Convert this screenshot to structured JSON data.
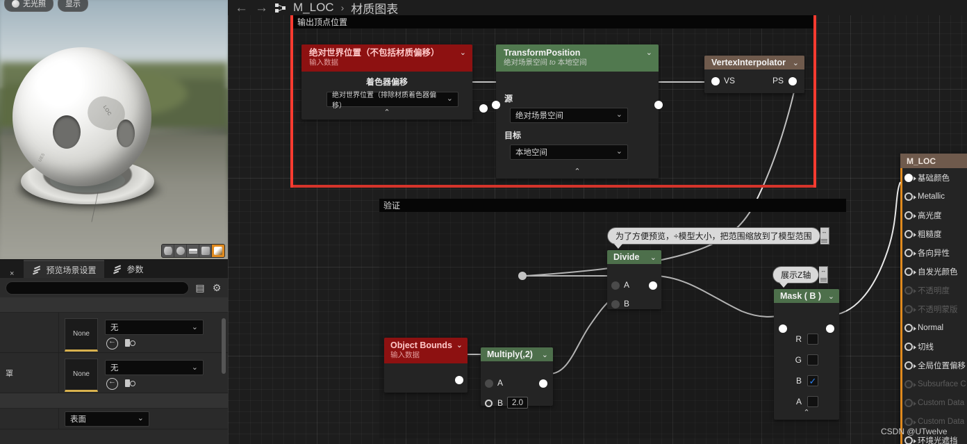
{
  "app": {
    "breadcrumb": {
      "asset": "M_LOC",
      "separator": "›",
      "section": "材质图表",
      "back_icon": "back-arrow-icon",
      "forward_icon": "forward-arrow-icon",
      "graph_icon": "material-graph-icon"
    },
    "watermark": "CSDN @UTwelve"
  },
  "viewport": {
    "buttons": [
      {
        "label": "无光照",
        "icon": "lighting-dot-icon"
      },
      {
        "label": "显示",
        "icon": "show-menu-icon"
      }
    ],
    "preview_shapes": [
      "cylinder-shape",
      "sphere-shape",
      "plane-shape",
      "cube-shape",
      "custom-mesh-shape"
    ]
  },
  "graph": {
    "comments": [
      {
        "title": "输出顶点位置",
        "highlight_color": "#ff3b30"
      },
      {
        "title": "验证",
        "highlight_color": "#060606"
      }
    ],
    "bubbles": [
      {
        "text": "为了方便预览，÷模型大小，把范围缩放到了模型范围"
      },
      {
        "text": "展示Z轴"
      }
    ],
    "nodes": {
      "abs_world_pos": {
        "title": "绝对世界位置（不包括材质偏移）",
        "subtitle": "输入数据",
        "field_label": "着色器偏移",
        "field_value": "绝对世界位置（排除材质着色器偏移）",
        "color": "#8d1111"
      },
      "transform_position": {
        "title": "TransformPosition",
        "subtitle_prefix": "绝对场景空间",
        "subtitle_italic": "to",
        "subtitle_suffix": "本地空间",
        "source_label": "源",
        "source_value": "绝对场景空间",
        "target_label": "目标",
        "target_value": "本地空间",
        "color": "#51794f"
      },
      "vertex_interpolator": {
        "title": "VertexInterpolator",
        "input_pin": "VS",
        "output_pin": "PS",
        "color": "#6f5a4c"
      },
      "divide": {
        "title": "Divide",
        "input_a": "A",
        "input_b": "B",
        "color": "#51794f"
      },
      "mask": {
        "title": "Mask ( B )",
        "channels": [
          {
            "label": "R",
            "checked": false
          },
          {
            "label": "G",
            "checked": false
          },
          {
            "label": "B",
            "checked": true
          },
          {
            "label": "A",
            "checked": false
          }
        ],
        "color": "#51794f"
      },
      "object_bounds": {
        "title": "Object Bounds",
        "subtitle": "输入数据",
        "color": "#8d1111"
      },
      "multiply": {
        "title": "Multiply(,2)",
        "input_a": "A",
        "input_b": "B",
        "b_value": "2.0",
        "color": "#51794f"
      }
    }
  },
  "details_panel": {
    "tabs": [
      {
        "label": "预览场景设置",
        "icon": "details-pen-icon",
        "active": true
      },
      {
        "label": "参数",
        "icon": "params-pen-icon",
        "active": false
      }
    ],
    "close_label": "×",
    "search_placeholder": "",
    "search_value": "",
    "toolbar_icons": [
      "grid-view-icon",
      "settings-gear-icon"
    ],
    "rows": [
      {
        "name": "",
        "thumb": "None",
        "value": "无"
      },
      {
        "name": "罩",
        "thumb": "None",
        "value": "无"
      }
    ],
    "surface_value": "表面"
  },
  "material_panel": {
    "title": "M_LOC",
    "pins": [
      {
        "label": "基础颜色",
        "enabled": true,
        "connected": true
      },
      {
        "label": "Metallic",
        "enabled": true,
        "connected": false
      },
      {
        "label": "高光度",
        "enabled": true,
        "connected": false
      },
      {
        "label": "粗糙度",
        "enabled": true,
        "connected": false
      },
      {
        "label": "各向异性",
        "enabled": true,
        "connected": false
      },
      {
        "label": "自发光颜色",
        "enabled": true,
        "connected": false
      },
      {
        "label": "不透明度",
        "enabled": false,
        "connected": false
      },
      {
        "label": "不透明蒙版",
        "enabled": false,
        "connected": false
      },
      {
        "label": "Normal",
        "enabled": true,
        "connected": false
      },
      {
        "label": "切线",
        "enabled": true,
        "connected": false
      },
      {
        "label": "全局位置偏移",
        "enabled": true,
        "connected": false
      },
      {
        "label": "Subsurface C",
        "enabled": false,
        "connected": false
      },
      {
        "label": "Custom Data",
        "enabled": false,
        "connected": false
      },
      {
        "label": "Custom Data",
        "enabled": false,
        "connected": false
      },
      {
        "label": "环境光遮挡",
        "enabled": true,
        "connected": false
      }
    ]
  }
}
